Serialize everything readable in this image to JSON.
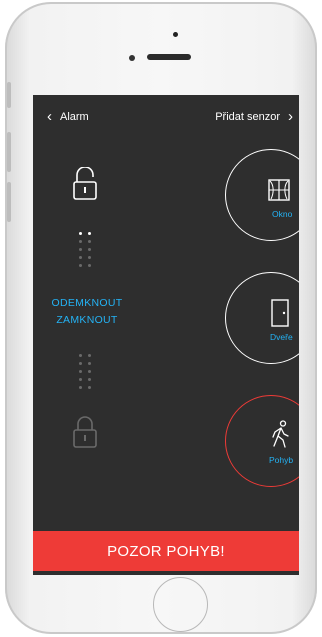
{
  "header": {
    "back_label": "Alarm",
    "add_label": "Přidat senzor"
  },
  "commands": {
    "unlock": "ODEMKNOUT",
    "lock": "ZAMKNOUT"
  },
  "sensors": [
    {
      "label": "Okno",
      "icon": "window-icon",
      "active": false
    },
    {
      "label": "Dveře",
      "icon": "door-icon",
      "active": false
    },
    {
      "label": "Pohyb",
      "icon": "walking-person-icon",
      "active": true
    }
  ],
  "alert": {
    "text": "POZOR POHYB!"
  },
  "colors": {
    "accent": "#24b3f5",
    "alert": "#ee3b37",
    "screen_bg": "#2e2e2e"
  }
}
